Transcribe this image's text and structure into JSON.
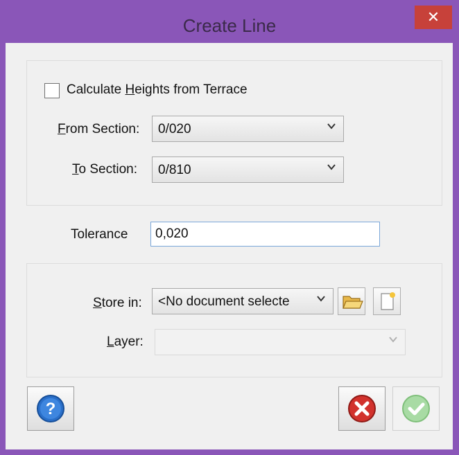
{
  "window": {
    "title": "Create Line",
    "close_glyph": "✕"
  },
  "calc_heights": {
    "label_pre": "Calculate ",
    "label_ul": "H",
    "label_post": "eights from Terrace",
    "checked": false
  },
  "from_section": {
    "label_ul": "F",
    "label_post": "rom Section:",
    "value": "0/020"
  },
  "to_section": {
    "label_ul": "T",
    "label_post": "o Section:",
    "value": "0/810"
  },
  "tolerance": {
    "label": "Tolerance",
    "value": "0,020"
  },
  "store_in": {
    "label_ul": "S",
    "label_post": "tore in:",
    "value": "<No document selecte"
  },
  "layer": {
    "label_ul": "L",
    "label_post": "ayer:",
    "value": ""
  },
  "icons": {
    "dropdown": "chevron-down-icon",
    "open_folder": "folder-open-icon",
    "new_document": "new-document-icon",
    "help": "help-icon",
    "cancel": "cancel-icon",
    "ok": "checkmark-icon"
  },
  "colors": {
    "frame": "#8a56b8",
    "close": "#c7413a",
    "help_blue": "#2a6fc9",
    "cancel_red": "#d2322d",
    "ok_green": "#7fd17a"
  }
}
